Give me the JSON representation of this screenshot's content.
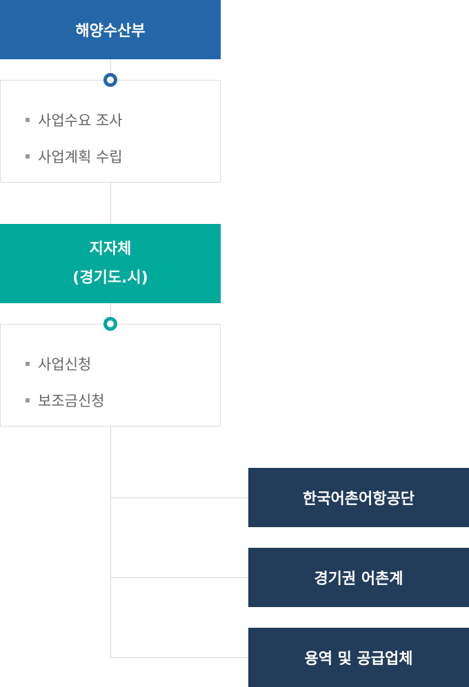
{
  "ministry": {
    "title": "해양수산부",
    "color": "#2467a9",
    "items": [
      "사업수요 조사",
      "사업계획 수립"
    ]
  },
  "local_government": {
    "title_line1": "지자체",
    "title_line2": "(경기도.시)",
    "color": "#00a99a",
    "items": [
      "사업신청",
      "보조금신청"
    ]
  },
  "organizations": [
    {
      "label": "한국어촌어항공단"
    },
    {
      "label": "경기권 어촌계"
    },
    {
      "label": "용역 및 공급업체"
    }
  ],
  "org_color": "#213d5b"
}
